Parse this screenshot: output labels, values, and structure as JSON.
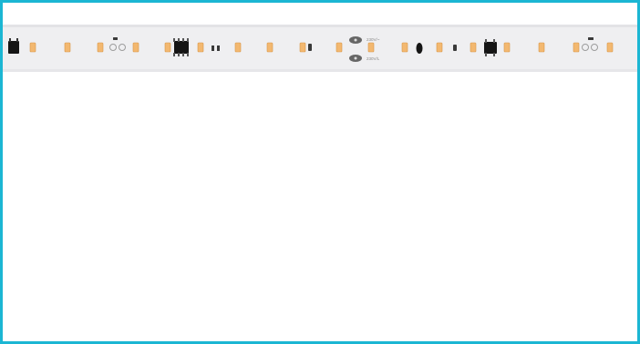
{
  "image": {
    "description_subject": "led-strip",
    "frame_color": "#1bb6d3",
    "background_color": "#ffffff",
    "strip_color": "#efeff1",
    "led_color": "#f3b870",
    "chip_color": "#151515"
  },
  "labels": {
    "upper_marking": "230V/~",
    "lower_marking": "230V/L"
  }
}
